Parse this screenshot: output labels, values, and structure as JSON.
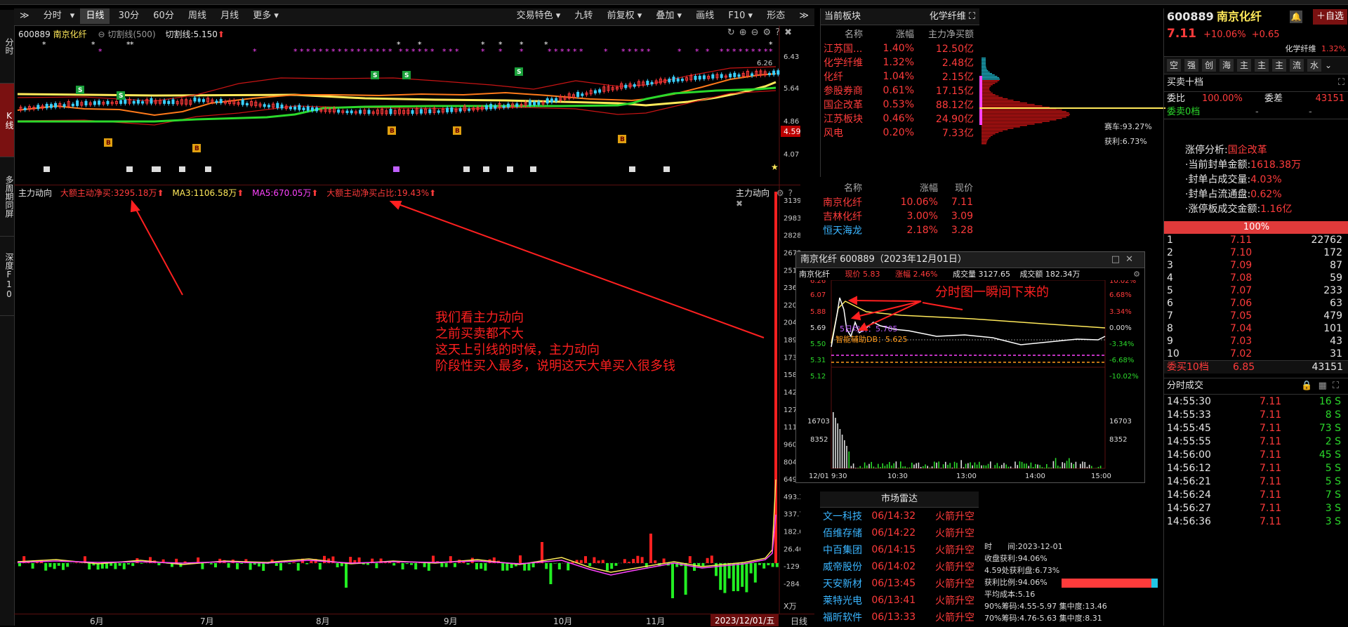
{
  "toolbar": {
    "left_items": [
      "分时",
      "日线",
      "30分",
      "60分",
      "周线",
      "月线",
      "更多"
    ],
    "right_items": [
      "交易特色",
      "九转",
      "前复权",
      "叠加",
      "画线",
      "F10",
      "形态"
    ]
  },
  "left_rail": [
    "分时",
    "K线",
    "多周期同屏",
    "深度F10"
  ],
  "kline": {
    "code": "600889",
    "name": "南京化纤",
    "indicator": "切割线(500)",
    "indicator_value": "切割线:5.150",
    "y_ticks": [
      "6.43",
      "5.64",
      "4.86",
      "4.07"
    ],
    "top_high": "6.26",
    "current_tag": "4.59",
    "legend_right": "赛车:93.27%",
    "legend_right2": "获利:6.73%"
  },
  "flow": {
    "title": "主力动向",
    "l1": "大额主动净买:3295.18万",
    "l2": "MA3:1106.58万",
    "l3": "MA5:670.05万",
    "l4": "大额主动净买占比:19.43%",
    "right_title": "主力动向",
    "y_ticks": [
      "3139.52",
      "2983.86",
      "2828.20",
      "2672.54",
      "2516.88",
      "2361.22",
      "2205.56",
      "2049.90",
      "1894.24",
      "1738.58",
      "1582.92",
      "1427.26",
      "1271.60",
      "1115.94",
      "960.28",
      "804.62",
      "649.03",
      "493.37",
      "337.71",
      "182.06",
      "26.40",
      "-129.25",
      "-284.91"
    ],
    "unit": "X万",
    "months": [
      "6月",
      "7月",
      "8月",
      "9月",
      "10月",
      "11月"
    ],
    "date_tag": "2023/12/01/五",
    "period_tag": "日线",
    "annotation": [
      "我们看主力动向",
      "之前买卖都不大",
      "这天上引线的时候，主力动向",
      "阶段性买入最多，说明这天大单买入很多钱"
    ]
  },
  "sector": {
    "header": "当前板块",
    "header_right": "化学纤维",
    "cols": [
      "名称",
      "涨幅",
      "主力净买额"
    ],
    "rows": [
      [
        "江苏国...",
        "1.40%",
        "12.50亿"
      ],
      [
        "化学纤维",
        "1.32%",
        "2.48亿"
      ],
      [
        "化纤",
        "1.04%",
        "2.15亿"
      ],
      [
        "参股券商",
        "0.61%",
        "17.15亿"
      ],
      [
        "国企改革",
        "0.53%",
        "88.12亿"
      ],
      [
        "江苏板块",
        "0.46%",
        "24.90亿"
      ],
      [
        "风电",
        "0.20%",
        "7.33亿"
      ]
    ],
    "cols2": [
      "名称",
      "涨幅",
      "现价"
    ],
    "rows2": [
      [
        "南京化纤",
        "10.06%",
        "7.11"
      ],
      [
        "吉林化纤",
        "3.00%",
        "3.09"
      ],
      [
        "恒天海龙",
        "2.18%",
        "3.28"
      ]
    ]
  },
  "popup": {
    "title": "南京化纤 600889（2023年12月01日）",
    "name": "南京化纤",
    "price": "现价 5.83",
    "chg": "涨幅 2.46%",
    "vol": "成交量 3127.65",
    "amt": "成交额 182.34万",
    "y_left": [
      "6.26",
      "6.07",
      "5.88",
      "5.69",
      "5.50",
      "5.31",
      "5.12"
    ],
    "y_right": [
      "10.02%",
      "6.68%",
      "3.34%",
      "0.00%",
      "-3.34%",
      "-6.68%",
      "-10.02%"
    ],
    "ma_label": "5日均价：5.705",
    "aux_label": "智能辅助DB：5.625",
    "vol_ticks": [
      "16703",
      "8352"
    ],
    "times": [
      "12/01 9:30",
      "10:30",
      "13:00",
      "14:00",
      "15:00"
    ],
    "annotation": "分时图一瞬间下来的"
  },
  "radar": {
    "title": "市场雷达",
    "rows": [
      [
        "文一科技",
        "06/14:32",
        "火箭升空"
      ],
      [
        "佰维存储",
        "06/14:22",
        "火箭升空"
      ],
      [
        "中百集团",
        "06/14:15",
        "火箭升空"
      ],
      [
        "威帝股份",
        "06/14:02",
        "火箭升空"
      ],
      [
        "天安新材",
        "06/13:45",
        "火箭升空"
      ],
      [
        "莱特光电",
        "06/13:41",
        "火箭升空"
      ],
      [
        "福昕软件",
        "06/13:33",
        "火箭升空"
      ]
    ]
  },
  "chip": {
    "time": "时　　间:2023-12-01",
    "l1": "收盘获利:94.06%",
    "l2": "4.59处获利盘:6.73%",
    "l3": "获利比例:94.06%",
    "l4": "平均成本:5.16",
    "l5": "90%筹码:4.55-5.97 集中度:13.46",
    "l6": "70%筹码:4.76-5.63 集中度:8.31"
  },
  "quote": {
    "code": "600889",
    "name": "南京化纤",
    "price": "7.11",
    "pct": "+10.06%",
    "chg": "+0.65",
    "add_label": "自选",
    "sector": "化学纤维",
    "sector_pct": "1.32%",
    "tabs": [
      "空",
      "强",
      "创",
      "海",
      "主",
      "主",
      "主",
      "流",
      "水"
    ],
    "book_title": "买卖十档",
    "wb_label": "委比",
    "wb_val": "100.00%",
    "wc_label": "委差",
    "wc_val": "43151",
    "sell0": "委卖0档",
    "limit_title": "涨停分析:",
    "limit_sector": "国企改革",
    "limit_rows": [
      [
        "·当前封单金额:",
        "1618.38万"
      ],
      [
        "·封单占成交量:",
        "4.03%"
      ],
      [
        "·封单占流通盘:",
        "0.62%"
      ],
      [
        "·涨停板成交金额:",
        "1.16亿"
      ]
    ],
    "bar_label": "100%",
    "bids": [
      [
        "1",
        "7.11",
        "22762"
      ],
      [
        "2",
        "7.10",
        "172"
      ],
      [
        "3",
        "7.09",
        "87"
      ],
      [
        "4",
        "7.08",
        "59"
      ],
      [
        "5",
        "7.07",
        "233"
      ],
      [
        "6",
        "7.06",
        "63"
      ],
      [
        "7",
        "7.05",
        "479"
      ],
      [
        "8",
        "7.04",
        "101"
      ],
      [
        "9",
        "7.03",
        "43"
      ],
      [
        "10",
        "7.02",
        "31"
      ]
    ],
    "buy10_label": "委买10档",
    "buy10_price": "6.85",
    "buy10_vol": "43151",
    "ticks_title": "分时成交",
    "ticks": [
      [
        "14:55:30",
        "7.11",
        "16 S"
      ],
      [
        "14:55:33",
        "7.11",
        "8 S"
      ],
      [
        "14:55:45",
        "7.11",
        "73 S"
      ],
      [
        "14:55:55",
        "7.11",
        "2 S"
      ],
      [
        "14:56:00",
        "7.11",
        "45 S"
      ],
      [
        "14:56:12",
        "7.11",
        "5 S"
      ],
      [
        "14:56:21",
        "7.11",
        "5 S"
      ],
      [
        "14:56:24",
        "7.11",
        "7 S"
      ],
      [
        "14:56:27",
        "7.11",
        "3 S"
      ],
      [
        "14:56:36",
        "7.11",
        "3 S"
      ]
    ]
  },
  "colors": {
    "up": "#ff3b3b",
    "down": "#2bd92b",
    "accent": "#7a1111"
  }
}
